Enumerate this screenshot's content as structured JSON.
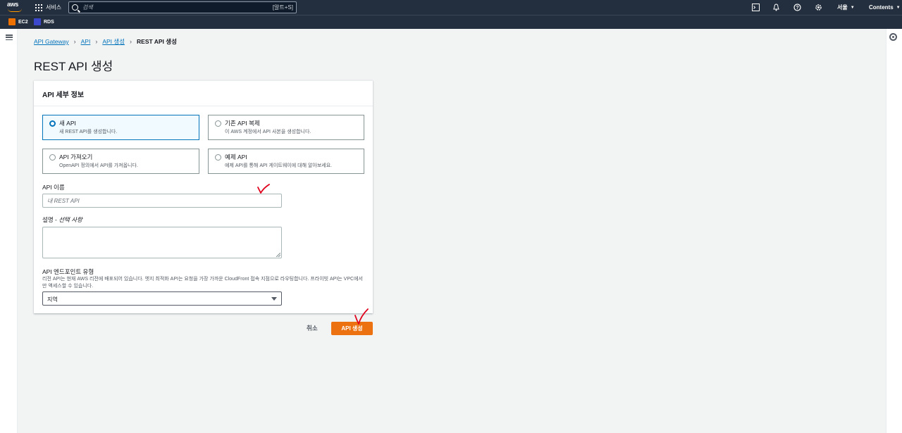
{
  "header": {
    "logo_text": "aws",
    "services_label": "서비스",
    "search_placeholder": "검색",
    "search_shortcut": "[알트+S]",
    "region": "서울",
    "account": "Contents"
  },
  "favorites": [
    {
      "label": "EC2"
    },
    {
      "label": "RDS"
    }
  ],
  "breadcrumb": {
    "items": [
      "API Gateway",
      "API",
      "API 생성"
    ],
    "current": "REST API 생성"
  },
  "page_title": "REST API 생성",
  "card": {
    "header": "API 세부 정보",
    "options": [
      {
        "title": "새 API",
        "desc": "새 REST API를 생성합니다.",
        "selected": true
      },
      {
        "title": "기존 API 복제",
        "desc": "이 AWS 계정에서 API 사본을 생성합니다.",
        "selected": false
      },
      {
        "title": "API 가져오기",
        "desc": "OpenAPI 정의에서 API를 가져옵니다.",
        "selected": false
      },
      {
        "title": "예제 API",
        "desc": "예제 API를 통해 API 게이트웨이에 대해 알아보세요.",
        "selected": false
      }
    ],
    "api_name_label": "API 이름",
    "api_name_placeholder": "내 REST API",
    "description_label": "설명",
    "description_optional": "선택 사항",
    "endpoint_label": "API 엔드포인트 유형",
    "endpoint_desc": "리전 API는 현재 AWS 리전에 배포되어 있습니다. 엣지 최적화 API는 요청을 가장 가까운 CloudFront 접속 지점으로 라우팅합니다. 프라이빗 API는 VPC에서만 액세스할 수 있습니다.",
    "endpoint_value": "지역"
  },
  "actions": {
    "cancel": "취소",
    "create": "API 생성"
  },
  "colors": {
    "nav_bg": "#232f3e",
    "primary_button": "#ec7211",
    "selected_border": "#0073bb",
    "annotation": "#e0001b"
  }
}
